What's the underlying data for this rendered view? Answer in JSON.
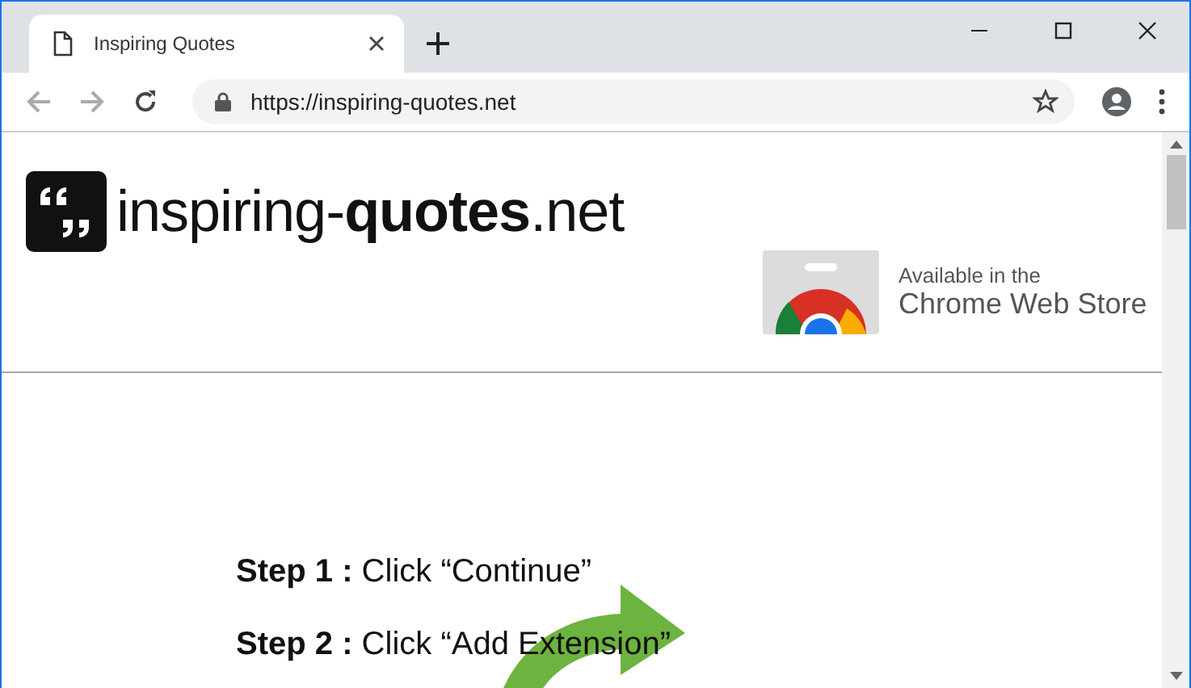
{
  "tabs": [
    {
      "title": "Inspiring Quotes",
      "selected": true
    }
  ],
  "address_bar": {
    "url": "https://inspiring-quotes.net"
  },
  "page": {
    "logo_text": "inspiring-**quotes**.net",
    "store_badge": {
      "line_1": "Available in the",
      "line_2": "Chrome Web Store"
    },
    "steps": [
      "**Step 1 :** Click “Continue”",
      "**Step 2 :** Click “Add Extension”"
    ]
  }
}
